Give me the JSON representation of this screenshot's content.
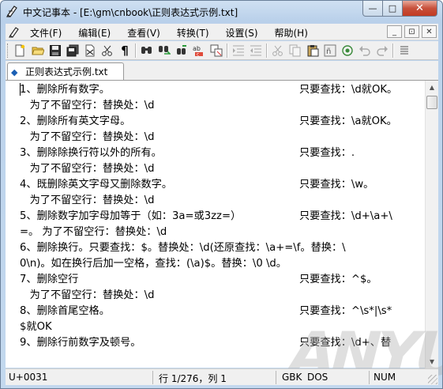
{
  "window": {
    "title": "中文记事本 - [E:\\gm\\cnbook\\正则表达式示例.txt]",
    "min_label": "—",
    "max_label": "□",
    "close_label": "✕"
  },
  "menu": {
    "items": [
      "文件(F)",
      "编辑(E)",
      "查看(V)",
      "转换(T)",
      "设置(S)",
      "帮助(H)"
    ],
    "mdi_min": "_",
    "mdi_restore": "⊡",
    "mdi_close": "✕"
  },
  "toolbar": {
    "icons": [
      "new-file",
      "open-folder",
      "save",
      "save-all",
      "close",
      "cut-scissors",
      "pilcrow",
      "find",
      "find-next",
      "find-replace",
      "replace",
      "convert",
      "indent",
      "outdent",
      "cut",
      "copy",
      "paste",
      "character-map",
      "settings",
      "undo",
      "redo"
    ]
  },
  "tab": {
    "label": "正则表达式示例.txt"
  },
  "editor": {
    "lines": [
      {
        "left": "1、删除所有数字。",
        "right": "只要查找：\\d就OK。"
      },
      {
        "left": "   为了不留空行：替换处：\\d",
        "right": ""
      },
      {
        "left": "2、删除所有英文字母。",
        "right": "只要查找：\\a就OK。"
      },
      {
        "left": "   为了不留空行：替换处：\\d",
        "right": ""
      },
      {
        "left": "3、删除除换行符以外的所有。",
        "right": "只要查找：."
      },
      {
        "left": "   为了不留空行：替换处：\\d",
        "right": ""
      },
      {
        "left": "4、既删除英文字母又删除数字。",
        "right": "只要查找：\\w。"
      },
      {
        "left": "   为了不留空行：替换处：\\d",
        "right": ""
      },
      {
        "left": "5、删除数字加字母加等于（如：3a=或3zz=）",
        "right": "只要查找：\\d+\\a+\\"
      },
      {
        "left": "=。 为了不留空行：替换处：\\d",
        "right": ""
      },
      {
        "left": "6、删除换行。只要查找：$。替换处：\\d(还原查找：\\a+=\\f。替换：\\",
        "right": ""
      },
      {
        "left": "0\\n)。如在换行后加一空格，查找：(\\a)$。替换：\\0 \\d。",
        "right": ""
      },
      {
        "left": "7、删除空行",
        "right": "只要查找：^$。"
      },
      {
        "left": "   为了不留空行：替换处：\\d",
        "right": ""
      },
      {
        "left": "8、删除首尾空格。",
        "right": "只要查找：^\\s*|\\s*"
      },
      {
        "left": "$就OK",
        "right": ""
      },
      {
        "left": "9、删除行前数字及顿号。",
        "right": "只要查找：\\d+、替"
      }
    ]
  },
  "status": {
    "code": "U+0031",
    "position": "行 1/276，列 1",
    "encoding": "GBK",
    "line_ending": "DOS",
    "numlock": "NUM"
  },
  "watermark": "ANYUN"
}
